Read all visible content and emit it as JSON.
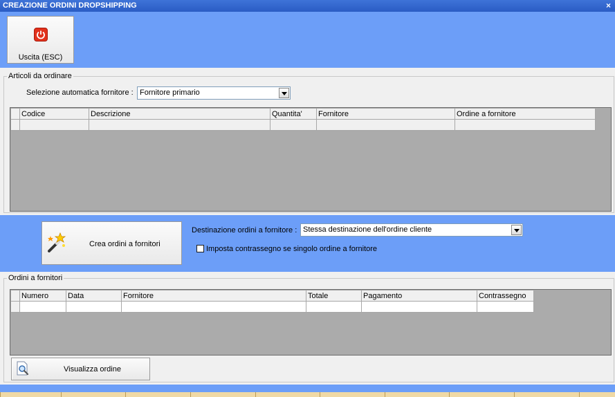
{
  "window": {
    "title": "CREAZIONE ORDINI DROPSHIPPING",
    "close_glyph": "×"
  },
  "toolbar": {
    "exit_label": "Uscita (ESC)",
    "exit_icon": "power-icon",
    "exit_icon_color": "#e2311c"
  },
  "articles": {
    "legend": "Articoli da ordinare",
    "supplier_select_label": "Selezione automatica fornitore :",
    "supplier_select_value": "Fornitore primario",
    "columns": [
      "Codice",
      "Descrizione",
      "Quantita'",
      "Fornitore",
      "Ordine a fornitore"
    ]
  },
  "actions": {
    "create_label": "Crea ordini a fornitori",
    "create_icon": "magic-wand-icon",
    "destination_label": "Destinazione ordini a fornitore :",
    "destination_value": "Stessa destinazione dell'ordine cliente",
    "cod_checkbox_label": "Imposta contrassegno se singolo ordine a fornitore",
    "cod_checked": false
  },
  "orders": {
    "legend": "Ordini a fornitori",
    "columns": [
      "Numero",
      "Data",
      "Fornitore",
      "Totale",
      "Pagamento",
      "Contrassegno"
    ],
    "view_label": "Visualizza ordine",
    "view_icon": "magnifier-document-icon"
  },
  "colors": {
    "background": "#6c9ef8",
    "titlebar": "#2a5cc4",
    "grid_empty": "#ababab",
    "taskbar": "#f0d9a5"
  }
}
